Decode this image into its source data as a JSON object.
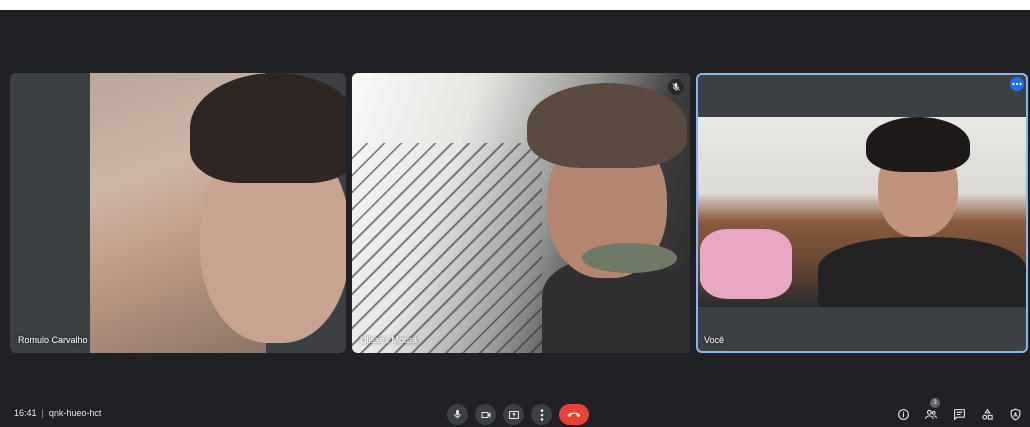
{
  "participants": [
    {
      "name": "Romulo Carvalho"
    },
    {
      "name": "Ulisses Moura"
    },
    {
      "name": "Você"
    }
  ],
  "meeting": {
    "time": "16:41",
    "separator": "|",
    "code": "qnk-hueo-hct"
  },
  "controls": {
    "mic_icon": "microphone-icon",
    "camera_icon": "camera-icon",
    "present_icon": "present-screen-icon",
    "more_icon": "more-vertical-icon",
    "end_call_icon": "end-call-icon"
  },
  "right_controls": {
    "people_count": "3",
    "icons": [
      "info-icon",
      "people-icon",
      "chat-icon",
      "activities-icon",
      "host-controls-icon"
    ]
  },
  "colors": {
    "background": "#202124",
    "tile": "#3c4043",
    "active_border": "#8ab4f8",
    "end_call": "#ea4335",
    "accent": "#1a73e8"
  }
}
